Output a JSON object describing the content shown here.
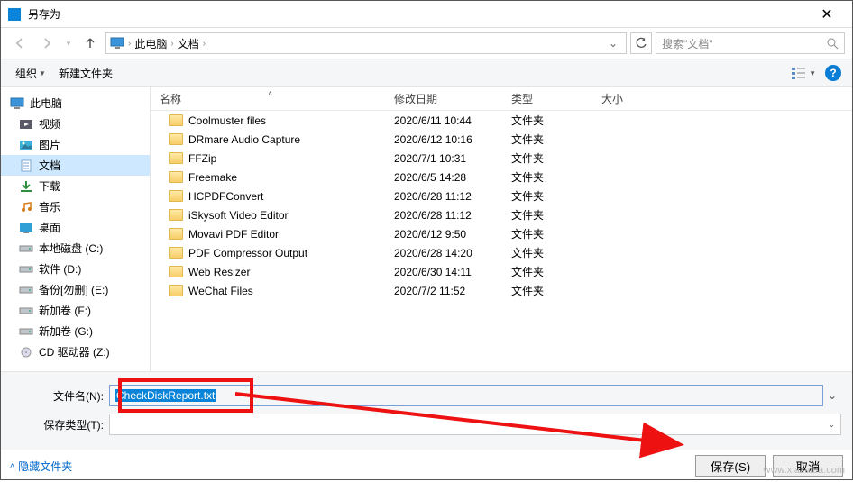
{
  "window": {
    "title": "另存为"
  },
  "nav": {
    "breadcrumb": [
      "此电脑",
      "文档"
    ],
    "search_placeholder": "搜索\"文档\""
  },
  "toolbar": {
    "organize": "组织",
    "new_folder": "新建文件夹"
  },
  "sidebar": {
    "items": [
      {
        "label": "此电脑",
        "icon": "pc"
      },
      {
        "label": "视频",
        "icon": "video"
      },
      {
        "label": "图片",
        "icon": "pictures"
      },
      {
        "label": "文档",
        "icon": "documents",
        "selected": true
      },
      {
        "label": "下载",
        "icon": "downloads"
      },
      {
        "label": "音乐",
        "icon": "music"
      },
      {
        "label": "桌面",
        "icon": "desktop"
      },
      {
        "label": "本地磁盘 (C:)",
        "icon": "drive"
      },
      {
        "label": "软件 (D:)",
        "icon": "drive"
      },
      {
        "label": "备份[勿删] (E:)",
        "icon": "drive"
      },
      {
        "label": "新加卷 (F:)",
        "icon": "drive"
      },
      {
        "label": "新加卷 (G:)",
        "icon": "drive"
      },
      {
        "label": "CD 驱动器 (Z:)",
        "icon": "cd"
      }
    ]
  },
  "columns": {
    "name": "名称",
    "date": "修改日期",
    "type": "类型",
    "size": "大小"
  },
  "files": [
    {
      "name": "Coolmuster files",
      "date": "2020/6/11 10:44",
      "type": "文件夹"
    },
    {
      "name": "DRmare Audio Capture",
      "date": "2020/6/12 10:16",
      "type": "文件夹"
    },
    {
      "name": "FFZip",
      "date": "2020/7/1 10:31",
      "type": "文件夹"
    },
    {
      "name": "Freemake",
      "date": "2020/6/5 14:28",
      "type": "文件夹"
    },
    {
      "name": "HCPDFConvert",
      "date": "2020/6/28 11:12",
      "type": "文件夹"
    },
    {
      "name": "iSkysoft Video Editor",
      "date": "2020/6/28 11:12",
      "type": "文件夹"
    },
    {
      "name": "Movavi PDF Editor",
      "date": "2020/6/12 9:50",
      "type": "文件夹"
    },
    {
      "name": "PDF Compressor Output",
      "date": "2020/6/28 14:20",
      "type": "文件夹"
    },
    {
      "name": "Web Resizer",
      "date": "2020/6/30 14:11",
      "type": "文件夹"
    },
    {
      "name": "WeChat Files",
      "date": "2020/7/2 11:52",
      "type": "文件夹"
    }
  ],
  "form": {
    "filename_label": "文件名(N):",
    "filename_value": "CheckDiskReport.txt",
    "type_label": "保存类型(T):",
    "type_value": ""
  },
  "actions": {
    "hide_folders": "隐藏文件夹",
    "save": "保存(S)",
    "cancel": "取消"
  },
  "watermark": "www.xiazaiba.com"
}
